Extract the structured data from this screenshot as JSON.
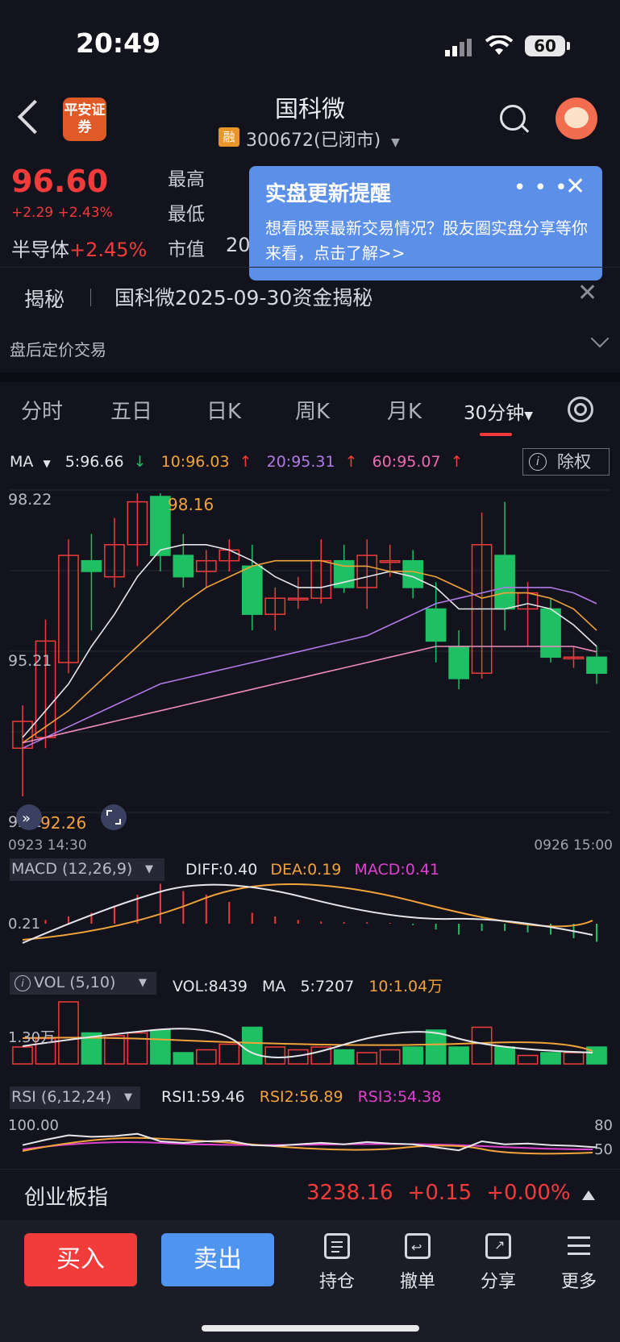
{
  "status_bar": {
    "time": "20:49",
    "battery": "60"
  },
  "header": {
    "broker_logo": "平安证券",
    "stock_name": "国科微",
    "rong_badge": "融",
    "stock_code": "300672(已闭市)"
  },
  "quote": {
    "price": "96.60",
    "change": "+2.29 +2.43%",
    "sector_name": "半导体",
    "sector_change": "+2.45%",
    "high_label": "最高",
    "low_label": "最低",
    "mv_label": "市值",
    "mv_value_partial": "20"
  },
  "popup": {
    "title": "实盘更新提醒",
    "body": "想看股票最新交易情况？股友圈实盘分享等你来看，点击了解>>"
  },
  "reveal": {
    "tag": "揭秘",
    "text": "国科微2025-09-30资金揭秘"
  },
  "after_hours": "盘后定价交易",
  "tabs": [
    "分时",
    "五日",
    "日K",
    "周K",
    "月K",
    "30分钟"
  ],
  "ma_row": {
    "label": "MA",
    "ma5": "5:96.66",
    "ma10": "10:96.03",
    "ma20": "20:95.31",
    "ma60": "60:95.07",
    "chuquan": "除权"
  },
  "kline": {
    "y_top": "98.22",
    "y_mid": "95.21",
    "y_bottom": "92.2",
    "max_label": "98.16",
    "min_label": "92.26",
    "x_start": "0923 14:30",
    "x_end": "0926 15:00"
  },
  "macd": {
    "title": "MACD (12,26,9)",
    "diff": "DIFF:0.40",
    "dea": "DEA:0.19",
    "macd": "MACD:0.41",
    "axis": "0.21"
  },
  "vol": {
    "title": "VOL (5,10)",
    "vol": "VOL:8439",
    "ma": "MA",
    "ma5": "5:7207",
    "ma10": "10:1.04万",
    "axis": "1.30万"
  },
  "rsi": {
    "title": "RSI (6,12,24)",
    "rsi1": "RSI1:59.46",
    "rsi2": "RSI2:56.89",
    "rsi3": "RSI3:54.38",
    "axis_top": "100.00",
    "r80": "80",
    "r50": "50"
  },
  "index_bar": {
    "name": "创业板指",
    "value": "3238.16",
    "change": "+0.15",
    "pct": "+0.00%"
  },
  "bottom_bar": {
    "buy": "买入",
    "sell": "卖出",
    "tools": [
      "持仓",
      "撤单",
      "分享",
      "更多"
    ]
  },
  "chart_data": {
    "type": "candlestick",
    "y_range": [
      92.2,
      98.22
    ],
    "x_range": [
      "0923 14:30",
      "0926 15:00"
    ],
    "candles": [
      {
        "o": 93.4,
        "c": 93.9,
        "h": 94.2,
        "l": 92.5
      },
      {
        "o": 93.6,
        "c": 95.4,
        "h": 95.8,
        "l": 93.4
      },
      {
        "o": 95.0,
        "c": 97.0,
        "h": 97.3,
        "l": 94.8
      },
      {
        "o": 96.9,
        "c": 96.7,
        "h": 97.4,
        "l": 95.6
      },
      {
        "o": 96.6,
        "c": 97.2,
        "h": 97.7,
        "l": 96.4
      },
      {
        "o": 97.2,
        "c": 98.0,
        "h": 98.16,
        "l": 96.8
      },
      {
        "o": 98.1,
        "c": 97.0,
        "h": 98.16,
        "l": 96.7
      },
      {
        "o": 97.0,
        "c": 96.6,
        "h": 97.4,
        "l": 96.4
      },
      {
        "o": 96.7,
        "c": 96.9,
        "h": 97.1,
        "l": 96.4
      },
      {
        "o": 96.9,
        "c": 97.1,
        "h": 97.3,
        "l": 96.7
      },
      {
        "o": 96.8,
        "c": 95.9,
        "h": 97.2,
        "l": 95.6
      },
      {
        "o": 95.9,
        "c": 96.2,
        "h": 96.4,
        "l": 95.6
      },
      {
        "o": 96.2,
        "c": 96.2,
        "h": 96.6,
        "l": 96.0
      },
      {
        "o": 96.2,
        "c": 96.9,
        "h": 97.3,
        "l": 96.1
      },
      {
        "o": 96.9,
        "c": 96.4,
        "h": 97.2,
        "l": 96.3
      },
      {
        "o": 96.4,
        "c": 97.0,
        "h": 97.3,
        "l": 96.0
      },
      {
        "o": 96.9,
        "c": 96.9,
        "h": 97.2,
        "l": 96.6
      },
      {
        "o": 96.9,
        "c": 96.4,
        "h": 97.1,
        "l": 96.2
      },
      {
        "o": 96.0,
        "c": 95.4,
        "h": 96.5,
        "l": 95.0
      },
      {
        "o": 95.3,
        "c": 94.7,
        "h": 95.6,
        "l": 94.5
      },
      {
        "o": 94.8,
        "c": 97.2,
        "h": 97.8,
        "l": 94.7
      },
      {
        "o": 97.0,
        "c": 96.0,
        "h": 98.0,
        "l": 95.6
      },
      {
        "o": 96.0,
        "c": 96.3,
        "h": 96.5,
        "l": 95.3
      },
      {
        "o": 96.0,
        "c": 95.1,
        "h": 96.2,
        "l": 95.0
      },
      {
        "o": 95.1,
        "c": 95.1,
        "h": 95.3,
        "l": 94.9
      },
      {
        "o": 95.1,
        "c": 94.8,
        "h": 95.3,
        "l": 94.6
      }
    ],
    "ma": [
      {
        "name": "5:96.66",
        "color": "#e6e6ea",
        "values": [
          93.6,
          94.1,
          94.6,
          95.3,
          95.9,
          96.6,
          97.1,
          97.2,
          97.2,
          97.1,
          96.9,
          96.6,
          96.4,
          96.4,
          96.5,
          96.6,
          96.7,
          96.6,
          96.4,
          96.0,
          96.0,
          96.0,
          96.1,
          96.0,
          95.7,
          95.3
        ]
      },
      {
        "name": "10:96.03",
        "color": "#f2a33a",
        "values": [
          93.5,
          93.8,
          94.1,
          94.5,
          94.9,
          95.3,
          95.7,
          96.1,
          96.4,
          96.6,
          96.8,
          96.9,
          96.9,
          96.9,
          96.8,
          96.8,
          96.7,
          96.7,
          96.6,
          96.4,
          96.2,
          96.3,
          96.3,
          96.2,
          96.0,
          95.6
        ]
      },
      {
        "name": "20:95.31",
        "color": "#b07be8",
        "values": [
          93.4,
          93.6,
          93.8,
          94.0,
          94.2,
          94.4,
          94.6,
          94.7,
          94.8,
          94.9,
          95.0,
          95.1,
          95.2,
          95.3,
          95.4,
          95.5,
          95.7,
          95.9,
          96.1,
          96.2,
          96.3,
          96.4,
          96.4,
          96.4,
          96.3,
          96.1
        ]
      },
      {
        "name": "60:95.07",
        "color": "#ee8cc0",
        "values": [
          93.5,
          93.6,
          93.7,
          93.8,
          93.9,
          94.0,
          94.1,
          94.2,
          94.3,
          94.4,
          94.5,
          94.6,
          94.7,
          94.8,
          94.9,
          95.0,
          95.1,
          95.2,
          95.3,
          95.3,
          95.3,
          95.3,
          95.3,
          95.3,
          95.3,
          95.2
        ]
      }
    ],
    "volume": {
      "values": [
        0.6,
        0.9,
        2.2,
        1.1,
        1.0,
        1.1,
        1.2,
        0.4,
        0.5,
        0.7,
        1.3,
        0.6,
        0.5,
        0.6,
        0.5,
        0.4,
        0.5,
        0.6,
        1.2,
        0.6,
        1.3,
        0.6,
        0.3,
        0.4,
        0.4,
        0.6
      ],
      "max": 2.4
    },
    "macd_hist": [
      0.0,
      0.05,
      0.1,
      0.15,
      0.25,
      0.4,
      0.55,
      0.45,
      0.4,
      0.3,
      0.15,
      0.1,
      0.05,
      0.03,
      0.02,
      0.02,
      0.01,
      -0.02,
      -0.08,
      -0.15,
      -0.1,
      -0.1,
      -0.12,
      -0.15,
      -0.2,
      -0.25
    ],
    "rsi_values": [
      55,
      62,
      68,
      66,
      67,
      70,
      60,
      58,
      60,
      61,
      55,
      54,
      56,
      58,
      56,
      59,
      57,
      56,
      52,
      48,
      60,
      56,
      57,
      55,
      54,
      52
    ]
  }
}
